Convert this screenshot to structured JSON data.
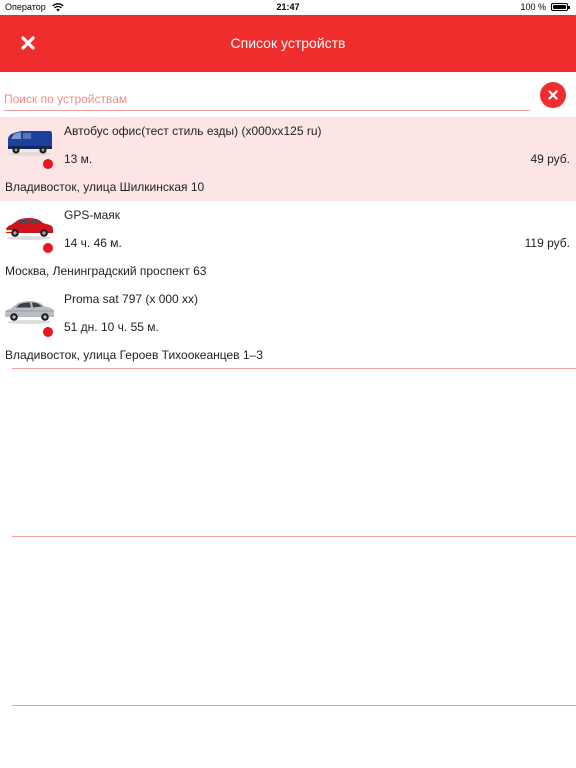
{
  "status_bar": {
    "carrier": "Оператор",
    "time": "21:47",
    "battery": "100 %"
  },
  "nav": {
    "title": "Список устройств",
    "close_icon": "close-icon"
  },
  "search": {
    "placeholder": "Поиск по устройствам",
    "value": ""
  },
  "colors": {
    "accent": "#ef2d2d",
    "selected_row": "#fde5e5",
    "status_dot": "#e8141e",
    "separator": "#f4a0a0"
  },
  "devices": [
    {
      "name": "Автобус офис(тест стиль езды) (х000хх125 ru)",
      "time": "13 м.",
      "price": "49 руб.",
      "address": "Владивосток, улица Шилкинская 10",
      "icon": "van-icon",
      "selected": true
    },
    {
      "name": "GPS-маяк",
      "time": "14 ч. 46 м.",
      "price": "119 руб.",
      "address": "Москва, Ленинградский проспект 63",
      "icon": "red-car-icon",
      "selected": false
    },
    {
      "name": "Proma sat 797 (х 000 хх)",
      "time": "51 дн. 10 ч. 55 м.",
      "price": "",
      "address": "Владивосток, улица Героев Тихоокеанцев 1–3",
      "icon": "silver-car-icon",
      "selected": false
    }
  ]
}
